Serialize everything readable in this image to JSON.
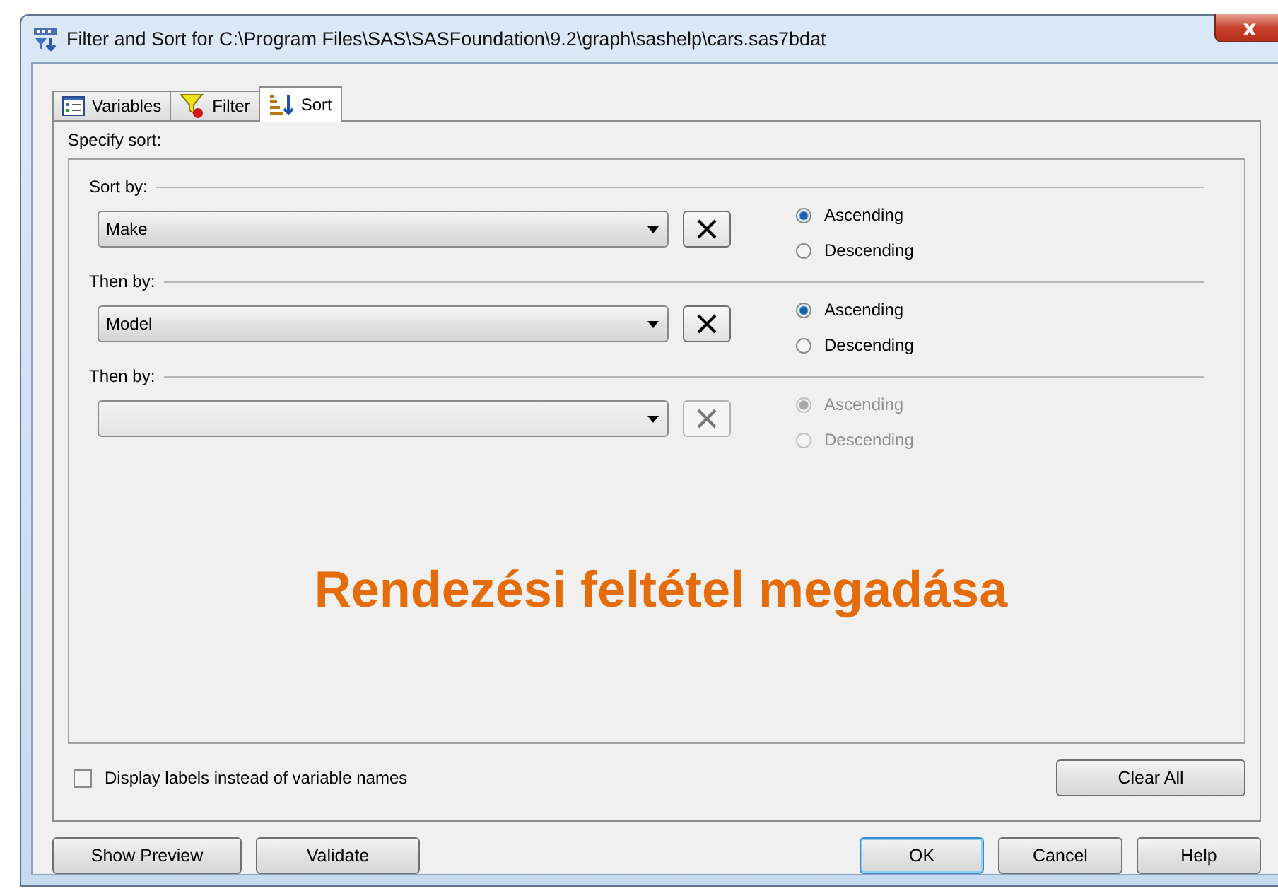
{
  "window": {
    "title": "Filter and Sort for C:\\Program Files\\SAS\\SASFoundation\\9.2\\graph\\sashelp\\cars.sas7bdat",
    "close": "x"
  },
  "tabs": [
    {
      "label": "Variables",
      "selected": false
    },
    {
      "label": "Filter",
      "selected": false
    },
    {
      "label": "Sort",
      "selected": true
    }
  ],
  "panel_label": "Specify sort:",
  "sort_levels": [
    {
      "label": "Sort by:",
      "value": "Make",
      "disabled": false,
      "orders": [
        {
          "label": "Ascending",
          "selected": true
        },
        {
          "label": "Descending",
          "selected": false
        }
      ]
    },
    {
      "label": "Then by:",
      "value": "Model",
      "disabled": false,
      "orders": [
        {
          "label": "Ascending",
          "selected": true
        },
        {
          "label": "Descending",
          "selected": false
        }
      ]
    },
    {
      "label": "Then by:",
      "disabled": true,
      "orders": [
        {
          "label": "Ascending",
          "selected": true
        },
        {
          "label": "Descending",
          "selected": false
        }
      ]
    }
  ],
  "overlay_caption": "Rendezési feltétel megadása",
  "display_labels": {
    "label": "Display labels instead of variable names",
    "checked": false
  },
  "clear_all": "Clear All",
  "left_buttons": [
    "Show Preview",
    "Validate"
  ],
  "right_buttons": [
    {
      "label": "OK",
      "selected": true
    },
    {
      "label": "Cancel",
      "selected": false
    },
    {
      "label": "Help",
      "selected": false
    }
  ]
}
